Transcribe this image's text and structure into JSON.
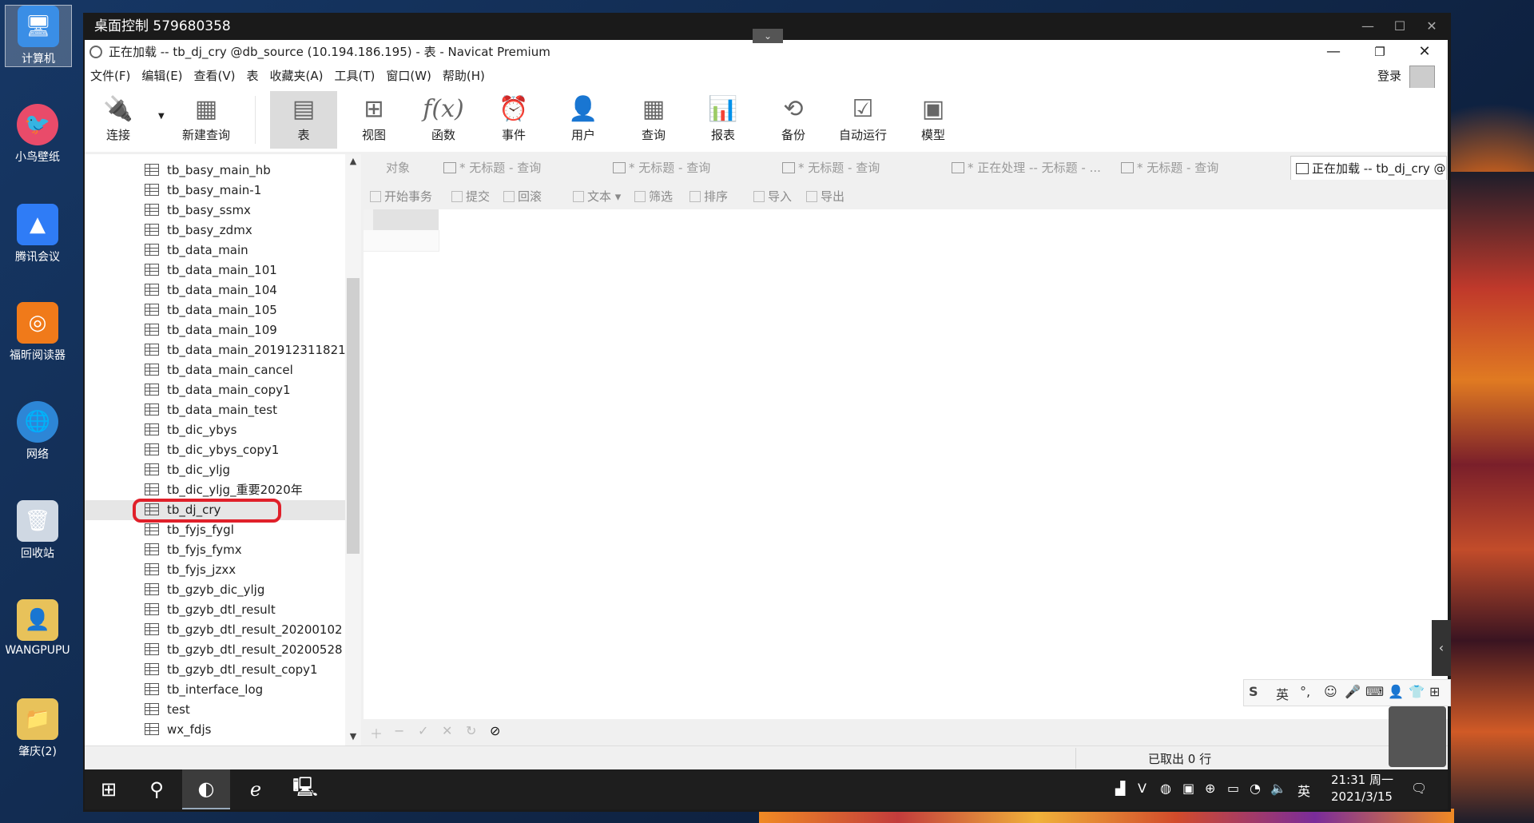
{
  "desktop": {
    "icons": [
      {
        "label": "计算机",
        "icon": "computer-icon"
      },
      {
        "label": "小鸟壁纸",
        "icon": "wallpaper-icon"
      },
      {
        "label": "腾讯会议",
        "icon": "meeting-icon"
      },
      {
        "label": "福昕阅读器",
        "icon": "pdf-icon"
      },
      {
        "label": "网络",
        "icon": "network-icon"
      },
      {
        "label": "回收站",
        "icon": "recycle-bin-icon"
      },
      {
        "label": "WANGPUPU",
        "icon": "user-folder-icon"
      },
      {
        "label": "肇庆(2)",
        "icon": "folder-icon"
      }
    ]
  },
  "remote": {
    "title": "桌面控制 579680358"
  },
  "navicat": {
    "title": "正在加载 -- tb_dj_cry @db_source (10.194.186.195) - 表 - Navicat Premium",
    "menu": [
      "文件(F)",
      "编辑(E)",
      "查看(V)",
      "表",
      "收藏夹(A)",
      "工具(T)",
      "窗口(W)",
      "帮助(H)"
    ],
    "login": "登录",
    "toolbar": [
      {
        "label": "连接",
        "icon": "connect-icon"
      },
      {
        "label": "新建查询",
        "icon": "new-query-icon"
      },
      {
        "label": "表",
        "icon": "table-icon",
        "active": true
      },
      {
        "label": "视图",
        "icon": "view-icon"
      },
      {
        "label": "函数",
        "icon": "function-icon"
      },
      {
        "label": "事件",
        "icon": "event-icon"
      },
      {
        "label": "用户",
        "icon": "user-icon"
      },
      {
        "label": "查询",
        "icon": "query-icon"
      },
      {
        "label": "报表",
        "icon": "report-icon"
      },
      {
        "label": "备份",
        "icon": "backup-icon"
      },
      {
        "label": "自动运行",
        "icon": "auto-run-icon"
      },
      {
        "label": "模型",
        "icon": "model-icon"
      }
    ],
    "tree": [
      "tb_basy_main_hb",
      "tb_basy_main-1",
      "tb_basy_ssmx",
      "tb_basy_zdmx",
      "tb_data_main",
      "tb_data_main_101",
      "tb_data_main_104",
      "tb_data_main_105",
      "tb_data_main_109",
      "tb_data_main_201912311821",
      "tb_data_main_cancel",
      "tb_data_main_copy1",
      "tb_data_main_test",
      "tb_dic_ybys",
      "tb_dic_ybys_copy1",
      "tb_dic_yljg",
      "tb_dic_yljg_重要2020年",
      "tb_dj_cry",
      "tb_fyjs_fygl",
      "tb_fyjs_fymx",
      "tb_fyjs_jzxx",
      "tb_gzyb_dic_yljg",
      "tb_gzyb_dtl_result",
      "tb_gzyb_dtl_result_20200102",
      "tb_gzyb_dtl_result_20200528",
      "tb_gzyb_dtl_result_copy1",
      "tb_interface_log",
      "test",
      "wx_fdjs"
    ],
    "tabs": [
      "对象",
      "* 无标题 - 查询",
      "* 无标题 - 查询",
      "* 无标题 - 查询",
      "* 正在处理 -- 无标题 - ...",
      "* 无标题 - 查询",
      "正在加载 -- tb_dj_cry @..."
    ],
    "actions": [
      "开始事务",
      "提交",
      "回滚",
      "文本",
      "筛选",
      "排序",
      "导入",
      "导出"
    ],
    "status": "已取出 0 行"
  },
  "ime": {
    "lang": "英"
  },
  "taskbar": {
    "time": "21:31 周一",
    "date": "2021/3/15",
    "tray_lang": "英"
  }
}
